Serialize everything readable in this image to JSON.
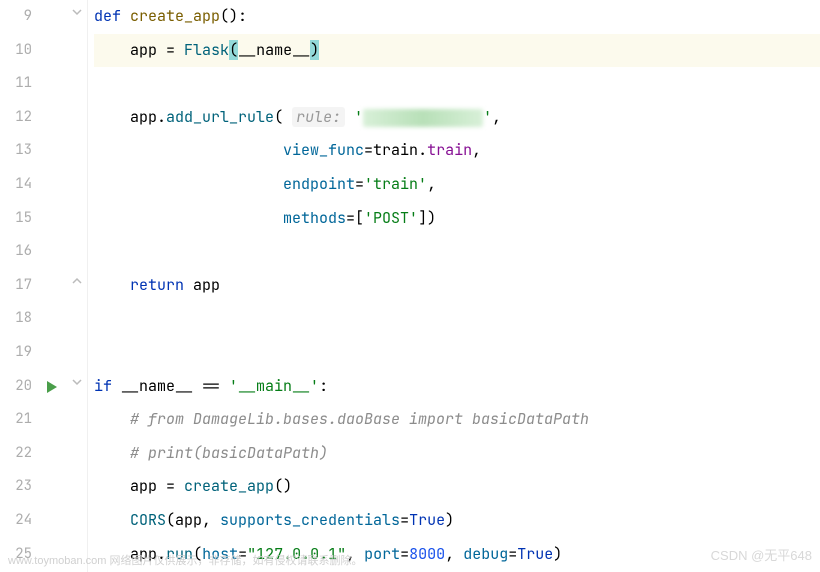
{
  "lines": [
    {
      "num": "9",
      "fold": "open"
    },
    {
      "num": "10",
      "highlighted": true
    },
    {
      "num": "11"
    },
    {
      "num": "12"
    },
    {
      "num": "13"
    },
    {
      "num": "14"
    },
    {
      "num": "15"
    },
    {
      "num": "16"
    },
    {
      "num": "17",
      "fold": "close"
    },
    {
      "num": "18"
    },
    {
      "num": "19"
    },
    {
      "num": "20",
      "run": true,
      "fold": "open"
    },
    {
      "num": "21"
    },
    {
      "num": "22"
    },
    {
      "num": "23"
    },
    {
      "num": "24"
    },
    {
      "num": "25"
    }
  ],
  "code": {
    "l9": {
      "kw_def": "def",
      "fn": "create_app",
      "paren": "():"
    },
    "l10": {
      "var": "app",
      "eq": " = ",
      "cls": "Flask",
      "open": "(",
      "name": "__name__",
      "close": ")"
    },
    "l12": {
      "obj": "app",
      "dot": ".",
      "method": "add_url_rule",
      "open": "(",
      "hint": "rule:",
      "str_q": "'",
      "comma": ","
    },
    "l13": {
      "param": "view_func",
      "eq": "=",
      "mod": "train",
      "dot": ".",
      "attr": "train",
      "comma": ","
    },
    "l14": {
      "param": "endpoint",
      "eq": "=",
      "str": "'train'",
      "comma": ","
    },
    "l15": {
      "param": "methods",
      "eq": "=[",
      "str": "'POST'",
      "close": "])"
    },
    "l17": {
      "kw": "return",
      "var": " app"
    },
    "l20": {
      "kw_if": "if",
      "name": " __name__ ",
      "eq": "== ",
      "str": "'__main__'",
      "colon": ":"
    },
    "l21": {
      "comment": "# from DamageLib.bases.daoBase import basicDataPath"
    },
    "l22": {
      "comment": "# print(basicDataPath)"
    },
    "l23": {
      "var": "app",
      "eq": " = ",
      "fn": "create_app",
      "paren": "()"
    },
    "l24": {
      "fn": "CORS",
      "open": "(app, ",
      "param": "supports_credentials",
      "eq": "=",
      "bool": "True",
      "close": ")"
    },
    "l25": {
      "obj": "app",
      "dot": ".",
      "method": "run",
      "open": "(",
      "p1": "host",
      "eq1": "=",
      "s1": "\"127.0.0.1\"",
      "c1": ", ",
      "p2": "port",
      "eq2": "=",
      "n2": "8000",
      "c2": ", ",
      "p3": "debug",
      "eq3": "=",
      "b3": "True",
      "close": ")"
    }
  },
  "watermarks": {
    "bottom_url": "www.toymoban.com",
    "bottom_text": " 网络图片仅供展示，非存储，如有侵权请联系删除。",
    "right": "CSDN @无平648"
  }
}
